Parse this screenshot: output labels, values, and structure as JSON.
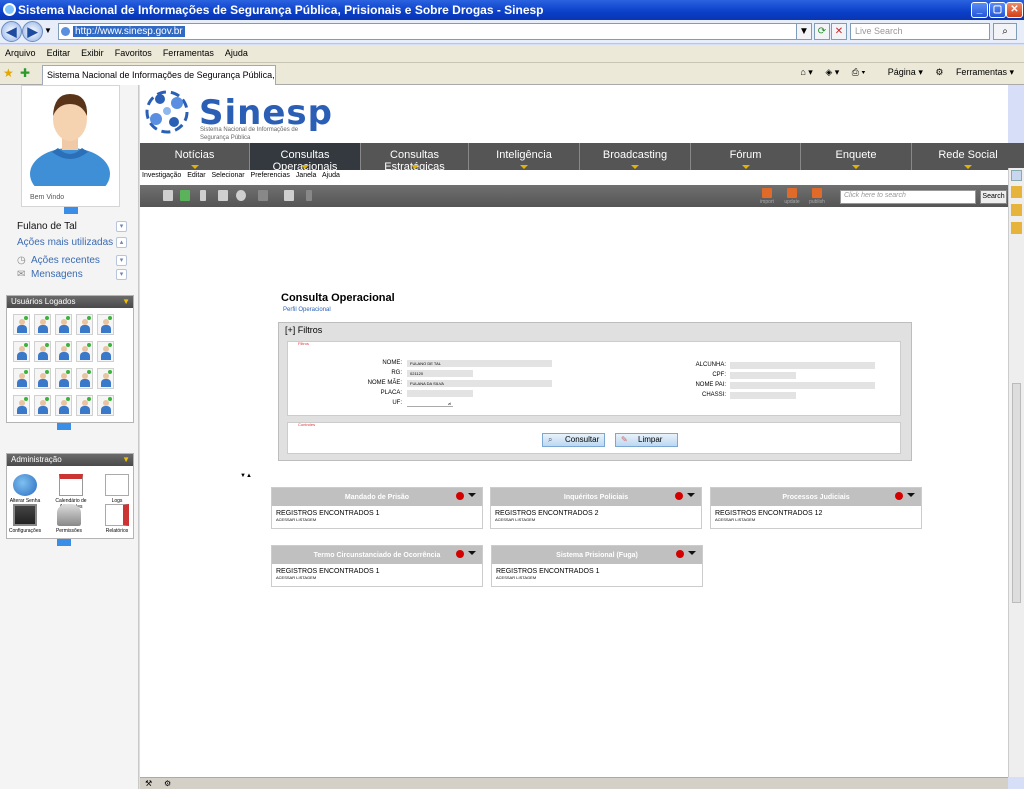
{
  "browser": {
    "window_title": "Sistema Nacional de Informações de Segurança Pública, Prisionais e Sobre Drogas - Sinesp",
    "url": "http://www.sinesp.gov.br",
    "live_search_placeholder": "Live Search",
    "menu": [
      "Arquivo",
      "Editar",
      "Exibir",
      "Favoritos",
      "Ferramentas",
      "Ajuda"
    ],
    "tab_title": "Sistema Nacional de Informações de Segurança Pública, Pris",
    "page_label": "Página",
    "tools_label": "Ferramentas"
  },
  "sidebar": {
    "welcome": "Bem Vindo",
    "user_name": "Fulano de Tal",
    "links": [
      "Ações mais utilizadas",
      "Ações recentes",
      "Mensagens"
    ],
    "logged_users_title": "Usuários Logados",
    "admin_title": "Administração",
    "admin_items": [
      "Alterar Senha",
      "Calendário de Atividades",
      "Logs",
      "Configurações",
      "Permissões",
      "Relatórios"
    ]
  },
  "site": {
    "logo": "Sinesp",
    "logo_sub": "Sistema Nacional de Informações de Segurança Pública",
    "nav": [
      "Notícias",
      "Consultas Operacionais",
      "Consultas Estratégicas",
      "Inteligência",
      "Broadcasting",
      "Fórum",
      "Enquete",
      "Rede Social"
    ],
    "submenu": [
      "Investigação",
      "Editar",
      "Selecionar",
      "Preferencias",
      "Janela",
      "Ajuda"
    ],
    "toolbar_right": [
      "import",
      "update",
      "publish"
    ],
    "search_placeholder": "Click here to search",
    "search_button": "Search"
  },
  "form": {
    "title": "Consulta Operacional",
    "subtitle": "Perfil Operacional",
    "filter_header": "[+] Filtros",
    "filter_legend": "Filtros",
    "controls_legend": "Controles",
    "fields_left": [
      {
        "label": "NOME:",
        "value": "FULANO DE TAL"
      },
      {
        "label": "RG:",
        "value": "021120"
      },
      {
        "label": "NOME MÃE:",
        "value": "FULANA DA SILVA"
      },
      {
        "label": "PLACA:",
        "value": ""
      },
      {
        "label": "UF:",
        "value": "zl"
      }
    ],
    "fields_right": [
      {
        "label": "ALCUNHA:",
        "value": ""
      },
      {
        "label": "CPF:",
        "value": ""
      },
      {
        "label": "NOME PAI:",
        "value": ""
      },
      {
        "label": "CHASSI:",
        "value": ""
      }
    ],
    "consult_button": "Consultar",
    "clear_button": "Limpar"
  },
  "results": [
    {
      "title": "Mandado de Prisão",
      "value": "REGISTROS ENCONTRADOS 1",
      "link": "ACESSAR LISTAGEM"
    },
    {
      "title": "Inquéritos Policiais",
      "value": "REGISTROS ENCONTRADOS 2",
      "link": "ACESSAR LISTAGEM"
    },
    {
      "title": "Processos Judiciais",
      "value": "REGISTROS ENCONTRADOS 12",
      "link": "ACESSAR LISTAGEM"
    },
    {
      "title": "Termo Circunstanciado de Ocorrência",
      "value": "REGISTROS ENCONTRADOS 1",
      "link": "ACESSAR LISTAGEM"
    },
    {
      "title": "Sistema Prisional (Fuga)",
      "value": "REGISTROS ENCONTRADOS 1",
      "link": "ACESSAR LISTAGEM"
    }
  ],
  "colors": {
    "title_bar": "#0a3fc8",
    "nav_bg": "#555555",
    "brand_blue": "#2a5fb5",
    "status_red": "#d40000"
  }
}
